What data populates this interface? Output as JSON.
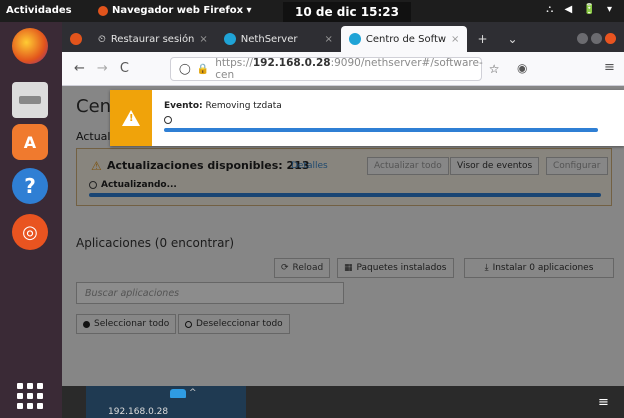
{
  "topbar": {
    "activities": "Actividades",
    "app_name": "Navegador web Firefox ▾",
    "clock": "10 de dic  15:23",
    "tray": "⛬ ◀ 🔋 ▾"
  },
  "dock": {
    "items": [
      "firefox-icon",
      "files-icon",
      "software-icon",
      "help-icon",
      "ubuntu-icon",
      "app-grid-icon"
    ]
  },
  "browser": {
    "tabs": [
      {
        "label": "Restaurar sesión",
        "close": "×"
      },
      {
        "label": "NethServer",
        "close": "×"
      },
      {
        "label": "Centro de Softw",
        "close": "×"
      }
    ],
    "new_tab": "+",
    "tab_list": "⌄",
    "url_prefix": "https://",
    "url_host": "192.168.0.28",
    "url_rest": ":9090/nethserver#/software-cen",
    "back": "←",
    "forward": "→",
    "reload": "C",
    "shield": "◯",
    "lock": "🔒",
    "star": "☆",
    "pocket": "◉",
    "menu": "≡"
  },
  "page": {
    "title": "Cent",
    "section": "Actual",
    "updates": {
      "available": "Actualizaciones disponibles: 213",
      "details_link": "Detalles",
      "update_all": "Actualizar todo",
      "view_events": "Visor de eventos",
      "configure": "Configurar",
      "status": "Actualizando..."
    },
    "apps": {
      "title": "Aplicaciones (0 encontrar)",
      "reload": "Reload",
      "installed": "Paquetes instalados",
      "install": "Instalar 0 aplicaciones",
      "search_placeholder": "Buscar aplicaciones",
      "select_all": "Seleccionar todo",
      "deselect_all": "Deseleccionar todo"
    }
  },
  "event": {
    "label": "Evento:",
    "message": "Removing tzdata"
  },
  "bottom": {
    "ip": "192.168.0.28",
    "menu": "≡"
  },
  "colors": {
    "accent": "#2f7fd4",
    "warning": "#f0a30a",
    "ubuntu_orange": "#e95420"
  }
}
